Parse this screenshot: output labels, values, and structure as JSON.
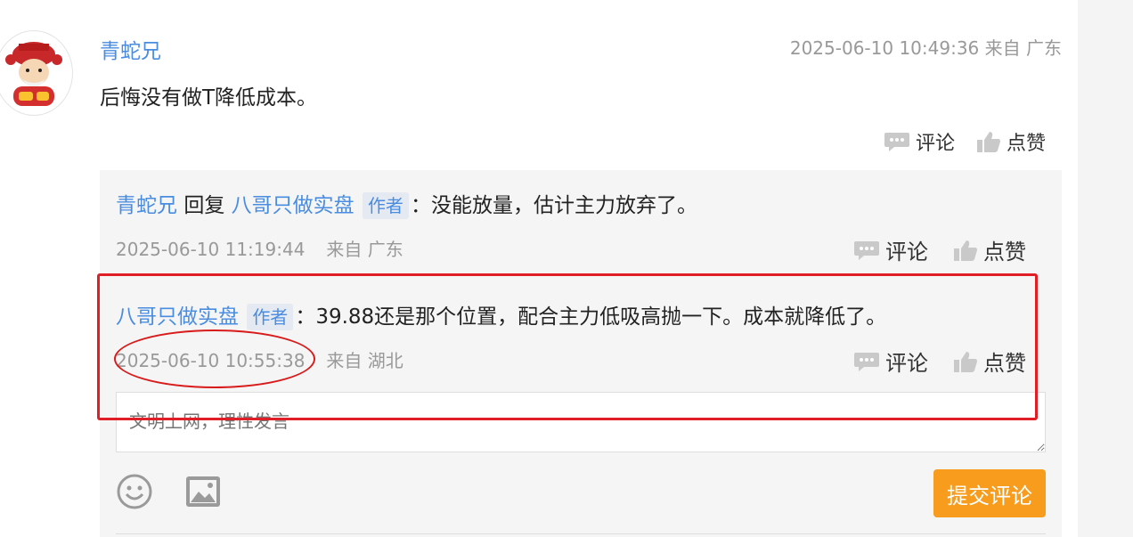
{
  "post": {
    "username": "青蛇兄",
    "time": "2025-06-10 10:49:36 来自 广东",
    "text": "后悔没有做T降低成本。",
    "actions": {
      "comment": "评论",
      "like": "点赞"
    }
  },
  "replies": [
    {
      "from": "青蛇兄",
      "reply_word": "回复",
      "to": "八哥只做实盘",
      "badge": "作者",
      "text": "：没能放量，估计主力放弃了。",
      "time": "2025-06-10 11:19:44",
      "location": "来自 广东",
      "comment_label": "评论",
      "like_label": "点赞"
    },
    {
      "from": "八哥只做实盘",
      "badge": "作者",
      "text": "：39.88还是那个位置，配合主力低吸高抛一下。成本就降低了。",
      "time": "2025-06-10 10:55:38",
      "location": "来自 湖北",
      "comment_label": "评论",
      "like_label": "点赞"
    }
  ],
  "input": {
    "placeholder": "文明上网，理性发言"
  },
  "toolbar": {
    "submit_label": "提交评论",
    "emoji_icon": "emoji-icon",
    "image_icon": "image-icon"
  },
  "colors": {
    "link": "#4a8de0",
    "accent": "#f79c1d",
    "annotation": "#e11d25"
  }
}
